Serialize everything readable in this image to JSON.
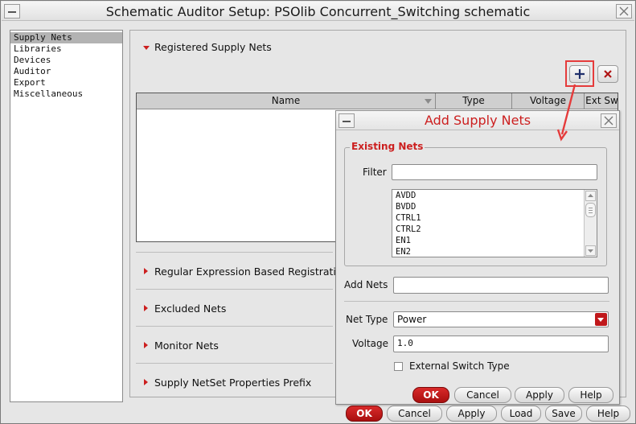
{
  "window": {
    "title": "Schematic Auditor Setup: PSOlib Concurrent_Switching schematic"
  },
  "sidebar": {
    "items": [
      {
        "label": "Supply Nets",
        "selected": true
      },
      {
        "label": "Libraries",
        "selected": false
      },
      {
        "label": "Devices",
        "selected": false
      },
      {
        "label": "Auditor",
        "selected": false
      },
      {
        "label": "Export",
        "selected": false
      },
      {
        "label": "Miscellaneous",
        "selected": false
      }
    ]
  },
  "main": {
    "registered_section": "Registered Supply Nets",
    "add_button_icon": "plus-icon",
    "remove_button_icon": "close-icon",
    "table": {
      "columns": [
        "Name",
        "Type",
        "Voltage",
        "Ext Sw"
      ]
    },
    "sections": [
      "Regular Expression Based Registration",
      "Excluded Nets",
      "Monitor Nets",
      "Supply NetSet Properties Prefix"
    ]
  },
  "dialog": {
    "title": "Add Supply Nets",
    "group_title": "Existing Nets",
    "filter_label": "Filter",
    "filter_value": "",
    "nets": [
      "AVDD",
      "BVDD",
      "CTRL1",
      "CTRL2",
      "EN1",
      "EN2"
    ],
    "add_nets_label": "Add Nets",
    "add_nets_value": "",
    "net_type_label": "Net Type",
    "net_type_value": "Power",
    "voltage_label": "Voltage",
    "voltage_value": "1.0",
    "ext_switch_label": "External Switch Type",
    "buttons": {
      "ok": "OK",
      "cancel": "Cancel",
      "apply": "Apply",
      "help": "Help"
    }
  },
  "footer": {
    "buttons": {
      "ok": "OK",
      "cancel": "Cancel",
      "apply": "Apply",
      "load": "Load",
      "save": "Save",
      "help": "Help"
    }
  },
  "colors": {
    "accent": "#cc1f1f",
    "highlight": "#e53b3b",
    "ok_button": "#c0181b"
  }
}
